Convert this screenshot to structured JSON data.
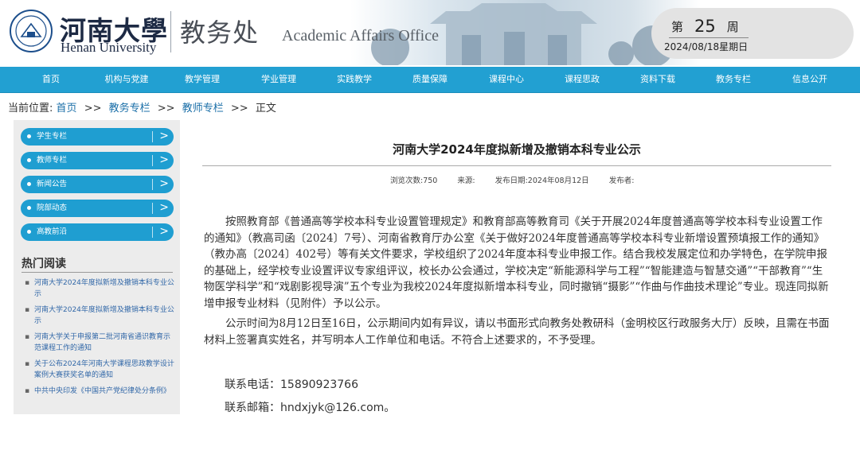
{
  "header": {
    "university_cn": "河南大學",
    "university_en": "Henan University",
    "office_cn": "教务处",
    "office_en": "Academic Affairs Office",
    "week_prefix": "第",
    "week_number": "25",
    "week_suffix": "周",
    "date": "2024/08/18星期日"
  },
  "nav": {
    "items": [
      "首页",
      "机构与党建",
      "教学管理",
      "学业管理",
      "实践教学",
      "质量保障",
      "课程中心",
      "课程思政",
      "资料下载",
      "教务专栏",
      "信息公开"
    ]
  },
  "breadcrumb": {
    "prefix": "当前位置:",
    "items": [
      "首页",
      "教务专栏",
      "教师专栏"
    ],
    "separator": ">>",
    "current": "正文"
  },
  "sidebar": {
    "menu": [
      "学生专栏",
      "教师专栏",
      "新闻公告",
      "院部动态",
      "高教前沿"
    ],
    "chevron": ">",
    "hot_title": "热门阅读",
    "hot_items": [
      "河南大学2024年度拟新增及撤销本科专业公示",
      "河南大学2024年度拟新增及撤销本科专业公示",
      "河南大学关于申报第二批河南省通识教育示范课程工作的通知",
      "关于公布2024年河南大学课程思政教学设计案例大赛获奖名单的通知",
      "中共中央印发《中国共产党纪律处分条例》"
    ]
  },
  "article": {
    "title": "河南大学2024年度拟新增及撤销本科专业公示",
    "views": "浏览次数:750",
    "source": "来源:",
    "publish_date": "发布日期:2024年08月12日",
    "publisher": "发布者:",
    "paragraph1": "按照教育部《普通高等学校本科专业设置管理规定》和教育部高等教育司《关于开展2024年度普通高等学校本科专业设置工作的通知》（教高司函〔2024〕7号）、河南省教育厅办公室《关于做好2024年度普通高等学校本科专业新增设置预填报工作的通知》（教办高〔2024〕402号）等有关文件要求，学校组织了2024年度本科专业申报工作。结合我校发展定位和办学特色，在学院申报的基础上，经学校专业设置评议专家组评议，校长办公会通过，学校决定“新能源科学与工程”“智能建造与智慧交通”“干部教育”“生物医学科学”和“戏剧影视导演”五个专业为我校2024年度拟新增本科专业，同时撤销“摄影”“作曲与作曲技术理论”专业。现连同拟新增申报专业材料（见附件）予以公示。",
    "paragraph2": "公示时间为8月12日至16日，公示期间内如有异议，请以书面形式向教务处教研科（金明校区行政服务大厅）反映，且需在书面材料上签署真实姓名，并写明本人工作单位和电话。不符合上述要求的，不予受理。",
    "phone_label": "联系电话：",
    "phone": "15890923766",
    "email_label": "联系邮箱：",
    "email": "hndxjyk@126.com",
    "email_suffix": "。"
  },
  "colors": {
    "nav_blue": "#22a0d2",
    "link_blue": "#1b6fa8",
    "sidebar_bg": "#ececec"
  }
}
